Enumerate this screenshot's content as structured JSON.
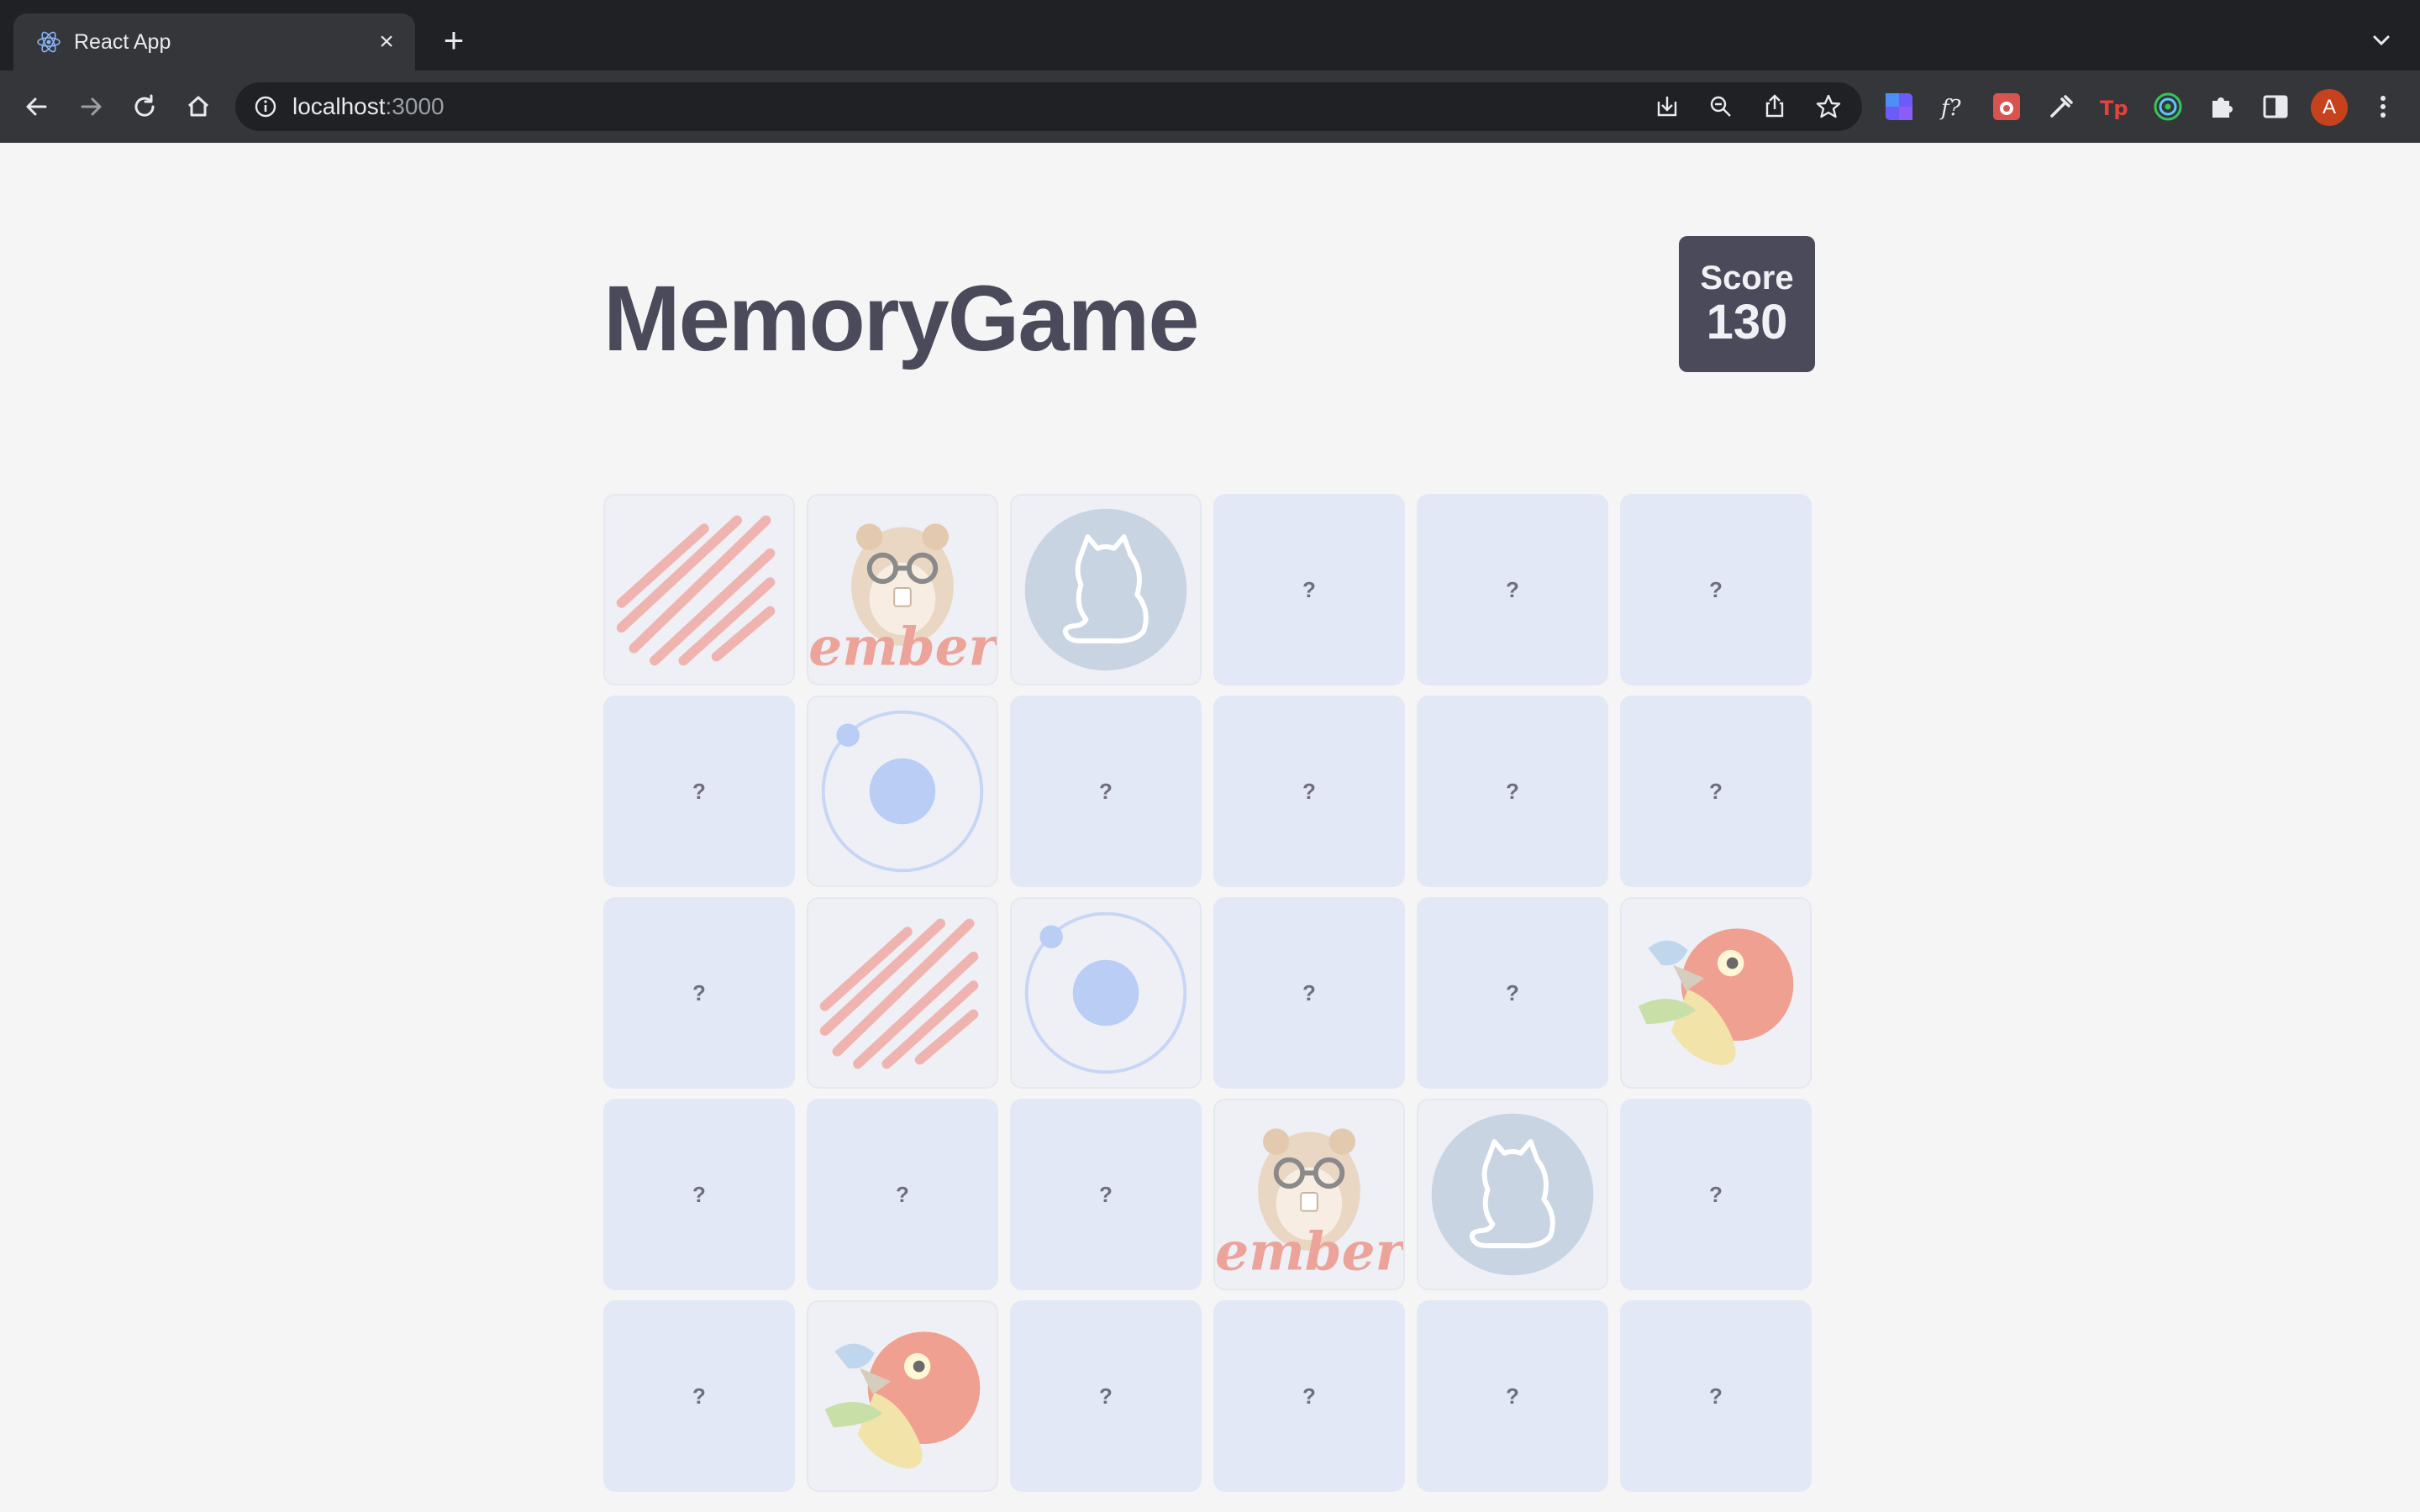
{
  "browser": {
    "tab_title": "React App",
    "tab_close": "×",
    "new_tab": "+",
    "url_host": "localhost",
    "url_port": ":3000",
    "profile_initial": "A",
    "extensions": [
      "tailwind-ext-icon",
      "fx-ext-icon",
      "bug-ext-icon",
      "eyedropper-ext-icon",
      "tp-ext-icon",
      "target-ext-icon",
      "puzzle-icon",
      "sidepanel-icon"
    ]
  },
  "game": {
    "title": "MemoryGame",
    "score_label": "Score",
    "score_value": "130",
    "hidden_symbol": "?",
    "grid": {
      "columns": 6,
      "rows": 5
    },
    "cards": [
      {
        "state": "up",
        "icon": "slashes"
      },
      {
        "state": "up",
        "icon": "ember"
      },
      {
        "state": "up",
        "icon": "github-cat"
      },
      {
        "state": "down"
      },
      {
        "state": "down"
      },
      {
        "state": "down"
      },
      {
        "state": "down"
      },
      {
        "state": "up",
        "icon": "orbit"
      },
      {
        "state": "down"
      },
      {
        "state": "down"
      },
      {
        "state": "down"
      },
      {
        "state": "down"
      },
      {
        "state": "down"
      },
      {
        "state": "up",
        "icon": "slashes"
      },
      {
        "state": "up",
        "icon": "orbit"
      },
      {
        "state": "down"
      },
      {
        "state": "down"
      },
      {
        "state": "up",
        "icon": "bird"
      },
      {
        "state": "down"
      },
      {
        "state": "down"
      },
      {
        "state": "down"
      },
      {
        "state": "up",
        "icon": "ember"
      },
      {
        "state": "up",
        "icon": "github-cat"
      },
      {
        "state": "down"
      },
      {
        "state": "down"
      },
      {
        "state": "up",
        "icon": "bird"
      },
      {
        "state": "down"
      },
      {
        "state": "down"
      },
      {
        "state": "down"
      },
      {
        "state": "down"
      }
    ]
  }
}
